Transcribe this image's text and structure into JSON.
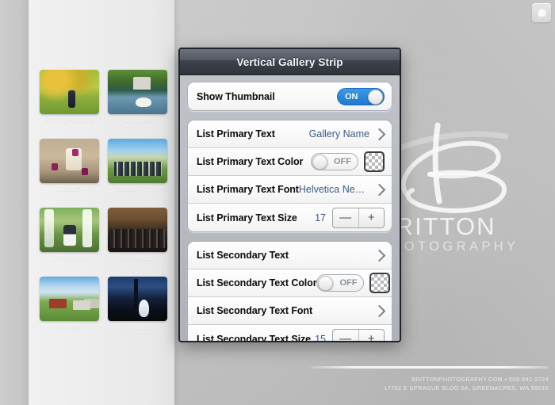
{
  "window": {
    "gear_icon": "gear-icon"
  },
  "gallery": {
    "thumbnails": [
      {
        "label": "Engagements",
        "photo": "ph-engagements"
      },
      {
        "label": "Couple",
        "photo": "ph-couple"
      },
      {
        "label": "Details",
        "photo": "ph-details"
      },
      {
        "label": "Bridal Party",
        "photo": "ph-bridal"
      },
      {
        "label": "Ceremony",
        "photo": "ph-ceremony"
      },
      {
        "label": "Reception",
        "photo": "ph-reception"
      },
      {
        "label": "Venues",
        "photo": "ph-venues"
      },
      {
        "label": "Albums",
        "photo": "ph-albums"
      }
    ]
  },
  "watermark": {
    "monogram": "B",
    "name": "BRITTON",
    "subtitle": "PHOTOGRAPHY"
  },
  "footer": {
    "line1": "BRITTONPHOTOGRAPHY.COM • 509-991-2724",
    "line2": "17702 E SPRAGUE BLDG 2A, GREENACRES, WA 99016"
  },
  "popover": {
    "title": "Vertical Gallery Strip",
    "group1": {
      "rows": [
        {
          "label": "Show Thumbnail",
          "control": "switch",
          "state": "ON"
        }
      ]
    },
    "group2": {
      "rows": [
        {
          "label": "List Primary Text",
          "control": "disclosure",
          "value": "Gallery Name"
        },
        {
          "label": "List Primary Text Color",
          "control": "switch-swatch",
          "state": "OFF",
          "swatch": "transparent"
        },
        {
          "label": "List Primary Text Font",
          "control": "disclosure",
          "value": "Helvetica Neue Li…"
        },
        {
          "label": "List Primary Text Size",
          "control": "stepper",
          "value": "17",
          "minus": "—",
          "plus": "+"
        }
      ]
    },
    "group3": {
      "rows": [
        {
          "label": "List Secondary Text",
          "control": "disclosure",
          "value": ""
        },
        {
          "label": "List Secondary Text Color",
          "control": "switch-swatch",
          "state": "OFF",
          "swatch": "transparent"
        },
        {
          "label": "List Secondary Text Font",
          "control": "disclosure",
          "value": ""
        },
        {
          "label": "List Secondary Text Size",
          "control": "stepper",
          "value": "15",
          "minus": "—",
          "plus": "+"
        }
      ]
    }
  },
  "colors": {
    "accent_blue": "#2f86dd",
    "value_text": "#3a5a86",
    "header_dark": "#3e434e"
  }
}
